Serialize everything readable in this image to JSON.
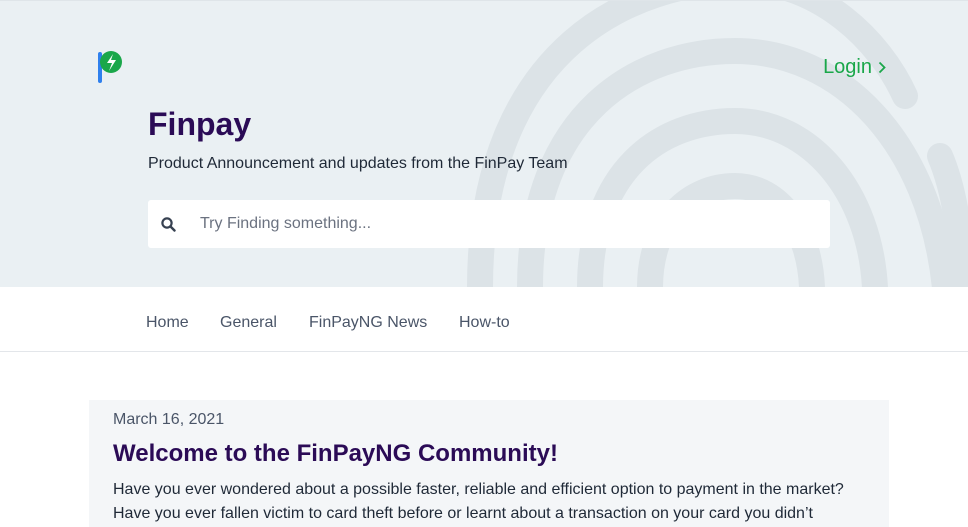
{
  "header": {
    "logo_icon": "finpay-logo-icon",
    "login_label": "Login",
    "title": "Finpay",
    "subtitle": "Product Announcement and updates from the FinPay Team"
  },
  "search": {
    "icon": "search-icon",
    "placeholder": "Try Finding something..."
  },
  "nav": {
    "items": [
      {
        "label": "Home"
      },
      {
        "label": "General"
      },
      {
        "label": "FinPayNG News"
      },
      {
        "label": "How-to"
      }
    ]
  },
  "post": {
    "date": "March 16, 2021",
    "title": "Welcome to the FinPayNG Community!",
    "excerpt": "Have you ever wondered about a possible faster, reliable and efficient option to payment in the market? Have you ever fallen victim to card theft before or learnt about a transaction on your card you didn’t"
  },
  "colors": {
    "hero_background": "#eaf0f3",
    "brand_purple": "#2b0b56",
    "login_green": "#1aa74a",
    "card_background": "#f4f6f8"
  }
}
